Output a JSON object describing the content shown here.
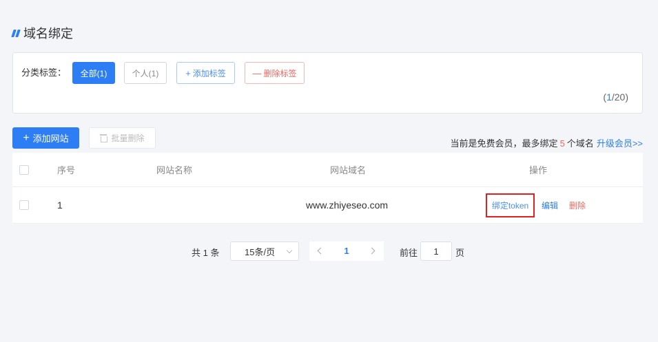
{
  "page": {
    "title": "域名绑定"
  },
  "tags": {
    "label": "分类标签：",
    "all": "全部(1)",
    "personal": "个人(1)",
    "add": "添加标签",
    "add_symbol": "+",
    "delete": "删除标签",
    "delete_symbol": "—",
    "count_open": "(",
    "count_current": "1",
    "count_rest": "/20)"
  },
  "toolbar": {
    "add_site": "添加网站",
    "add_symbol": "+",
    "batch_delete": "批量删除",
    "member_prefix": "当前是免费会员，最多绑定",
    "member_limit": "5",
    "member_suffix": "个域名",
    "upgrade_link": "升级会员>>"
  },
  "table": {
    "headers": {
      "no": "序号",
      "name": "网站名称",
      "domain": "网站域名",
      "ops": "操作"
    },
    "rows": [
      {
        "no": "1",
        "name": "",
        "domain": "www.zhiyeseo.com",
        "bind_token": "绑定token",
        "edit": "编辑",
        "delete": "删除"
      }
    ]
  },
  "pagination": {
    "total": "共 1 条",
    "page_size": "15条/页",
    "current_page": "1",
    "goto_label": "前往",
    "goto_value": "1",
    "page_suffix": "页"
  },
  "colors": {
    "primary": "#2d7ef4",
    "danger": "#f0665f",
    "highlight_box": "#e02020"
  }
}
